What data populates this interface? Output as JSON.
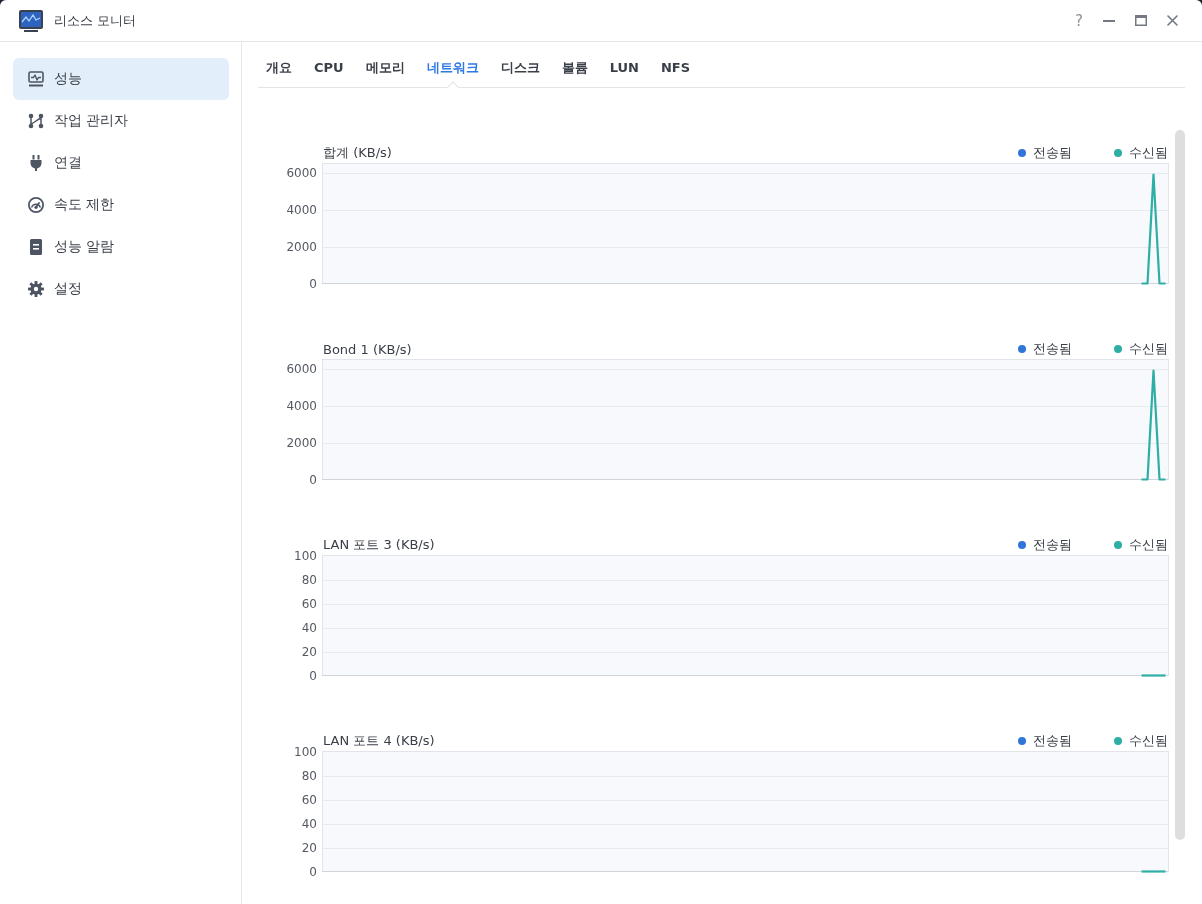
{
  "window": {
    "title": "리소스 모니터",
    "help": "?"
  },
  "sidebar": {
    "items": [
      {
        "label": "성능",
        "selected": true
      },
      {
        "label": "작업 관리자",
        "selected": false
      },
      {
        "label": "연결",
        "selected": false
      },
      {
        "label": "속도 제한",
        "selected": false
      },
      {
        "label": "성능 알람",
        "selected": false
      },
      {
        "label": "설정",
        "selected": false
      }
    ]
  },
  "tabs": [
    {
      "label": "개요",
      "selected": false
    },
    {
      "label": "CPU",
      "selected": false
    },
    {
      "label": "메모리",
      "selected": false
    },
    {
      "label": "네트워크",
      "selected": true
    },
    {
      "label": "디스크",
      "selected": false
    },
    {
      "label": "볼륨",
      "selected": false
    },
    {
      "label": "LUN",
      "selected": false
    },
    {
      "label": "NFS",
      "selected": false
    }
  ],
  "charts": [
    {
      "chart_data": {
        "type": "line",
        "title": "합계 (KB/s)",
        "grid": true,
        "categories": [
          null,
          null,
          null,
          null,
          null,
          null,
          null,
          null,
          null,
          null,
          null,
          null,
          null,
          null,
          null,
          null,
          null,
          null,
          null,
          null,
          null,
          null,
          null,
          null,
          null,
          null,
          null,
          null,
          null,
          null,
          null,
          null,
          null,
          null,
          null,
          null,
          null,
          null,
          null,
          null,
          null,
          null,
          null,
          null,
          null,
          null,
          null,
          null,
          null,
          null,
          null,
          null,
          null,
          null,
          null,
          null,
          null,
          null,
          null,
          null,
          null,
          null,
          null,
          null,
          null,
          null,
          null,
          null,
          null,
          null,
          null,
          null,
          null,
          null,
          null,
          null,
          null,
          null,
          null,
          null,
          null,
          null,
          null,
          null,
          null,
          null,
          null,
          null,
          null,
          null,
          null,
          null,
          null,
          null,
          null,
          null,
          null,
          null,
          null,
          null,
          null,
          null,
          null,
          null,
          null,
          null,
          null,
          null,
          null,
          null,
          null,
          null,
          null,
          null,
          null,
          null,
          null,
          null,
          null,
          null,
          null,
          null,
          null,
          null,
          null,
          null,
          null,
          null,
          null,
          null,
          null,
          null,
          null,
          null,
          null,
          null,
          null,
          null,
          null,
          null,
          null
        ],
        "ylim": [
          0,
          6500
        ],
        "yticks": [
          0,
          2000,
          4000,
          6000
        ],
        "series": [
          {
            "name": "전송됨",
            "color": "#2f76d9",
            "values": [
              null,
              null,
              null,
              null,
              null,
              null,
              null,
              null,
              null,
              null,
              null,
              null,
              null,
              null,
              null,
              null,
              null,
              null,
              null,
              null,
              null,
              null,
              null,
              null,
              null,
              null,
              null,
              null,
              null,
              null,
              null,
              null,
              null,
              null,
              null,
              null,
              null,
              null,
              null,
              null,
              null,
              null,
              null,
              null,
              null,
              null,
              null,
              null,
              null,
              null,
              null,
              null,
              null,
              null,
              null,
              null,
              null,
              null,
              null,
              null,
              null,
              null,
              null,
              null,
              null,
              null,
              null,
              null,
              null,
              null,
              null,
              null,
              null,
              null,
              null,
              null,
              null,
              null,
              null,
              null,
              null,
              null,
              null,
              null,
              null,
              null,
              null,
              null,
              null,
              null,
              null,
              null,
              null,
              null,
              null,
              null,
              null,
              null,
              null,
              null,
              null,
              null,
              null,
              null,
              null,
              null,
              null,
              null,
              null,
              null,
              null,
              null,
              null,
              null,
              null,
              null,
              null,
              null,
              null,
              null,
              null,
              null,
              null,
              null,
              null,
              null,
              null,
              null,
              null,
              null,
              null,
              null,
              null,
              null,
              null,
              null,
              null,
              null,
              null,
              null,
              null
            ]
          },
          {
            "name": "수신됨",
            "color": "#2eaea5",
            "values": [
              null,
              null,
              null,
              null,
              null,
              null,
              null,
              null,
              null,
              null,
              null,
              null,
              null,
              null,
              null,
              null,
              null,
              null,
              null,
              null,
              null,
              null,
              null,
              null,
              null,
              null,
              null,
              null,
              null,
              null,
              null,
              null,
              null,
              null,
              null,
              null,
              null,
              null,
              null,
              null,
              null,
              null,
              null,
              null,
              null,
              null,
              null,
              null,
              null,
              null,
              null,
              null,
              null,
              null,
              null,
              null,
              null,
              null,
              null,
              null,
              null,
              null,
              null,
              null,
              null,
              null,
              null,
              null,
              null,
              null,
              null,
              null,
              null,
              null,
              null,
              null,
              null,
              null,
              null,
              null,
              null,
              null,
              null,
              null,
              null,
              null,
              null,
              null,
              null,
              null,
              null,
              null,
              null,
              null,
              null,
              null,
              null,
              null,
              null,
              null,
              null,
              null,
              null,
              null,
              null,
              null,
              null,
              null,
              null,
              null,
              null,
              null,
              null,
              null,
              null,
              null,
              null,
              null,
              null,
              null,
              null,
              null,
              null,
              null,
              null,
              null,
              null,
              null,
              null,
              null,
              null,
              null,
              null,
              null,
              null,
              null,
              0,
              0,
              5900,
              0,
              0
            ]
          }
        ]
      }
    },
    {
      "chart_data": {
        "type": "line",
        "title": "Bond 1 (KB/s)",
        "grid": true,
        "categories": [
          null,
          null,
          null,
          null,
          null,
          null,
          null,
          null,
          null,
          null,
          null,
          null,
          null,
          null,
          null,
          null,
          null,
          null,
          null,
          null,
          null,
          null,
          null,
          null,
          null,
          null,
          null,
          null,
          null,
          null,
          null,
          null,
          null,
          null,
          null,
          null,
          null,
          null,
          null,
          null,
          null,
          null,
          null,
          null,
          null,
          null,
          null,
          null,
          null,
          null,
          null,
          null,
          null,
          null,
          null,
          null,
          null,
          null,
          null,
          null,
          null,
          null,
          null,
          null,
          null,
          null,
          null,
          null,
          null,
          null,
          null,
          null,
          null,
          null,
          null,
          null,
          null,
          null,
          null,
          null,
          null,
          null,
          null,
          null,
          null,
          null,
          null,
          null,
          null,
          null,
          null,
          null,
          null,
          null,
          null,
          null,
          null,
          null,
          null,
          null,
          null,
          null,
          null,
          null,
          null,
          null,
          null,
          null,
          null,
          null,
          null,
          null,
          null,
          null,
          null,
          null,
          null,
          null,
          null,
          null,
          null,
          null,
          null,
          null,
          null,
          null,
          null,
          null,
          null,
          null,
          null,
          null,
          null,
          null,
          null,
          null,
          null,
          null,
          null,
          null,
          null
        ],
        "ylim": [
          0,
          6500
        ],
        "yticks": [
          0,
          2000,
          4000,
          6000
        ],
        "series": [
          {
            "name": "전송됨",
            "color": "#2f76d9",
            "values": [
              null,
              null,
              null,
              null,
              null,
              null,
              null,
              null,
              null,
              null,
              null,
              null,
              null,
              null,
              null,
              null,
              null,
              null,
              null,
              null,
              null,
              null,
              null,
              null,
              null,
              null,
              null,
              null,
              null,
              null,
              null,
              null,
              null,
              null,
              null,
              null,
              null,
              null,
              null,
              null,
              null,
              null,
              null,
              null,
              null,
              null,
              null,
              null,
              null,
              null,
              null,
              null,
              null,
              null,
              null,
              null,
              null,
              null,
              null,
              null,
              null,
              null,
              null,
              null,
              null,
              null,
              null,
              null,
              null,
              null,
              null,
              null,
              null,
              null,
              null,
              null,
              null,
              null,
              null,
              null,
              null,
              null,
              null,
              null,
              null,
              null,
              null,
              null,
              null,
              null,
              null,
              null,
              null,
              null,
              null,
              null,
              null,
              null,
              null,
              null,
              null,
              null,
              null,
              null,
              null,
              null,
              null,
              null,
              null,
              null,
              null,
              null,
              null,
              null,
              null,
              null,
              null,
              null,
              null,
              null,
              null,
              null,
              null,
              null,
              null,
              null,
              null,
              null,
              null,
              null,
              null,
              null,
              null,
              null,
              null,
              null,
              null,
              null,
              null,
              null,
              null
            ]
          },
          {
            "name": "수신됨",
            "color": "#2eaea5",
            "values": [
              null,
              null,
              null,
              null,
              null,
              null,
              null,
              null,
              null,
              null,
              null,
              null,
              null,
              null,
              null,
              null,
              null,
              null,
              null,
              null,
              null,
              null,
              null,
              null,
              null,
              null,
              null,
              null,
              null,
              null,
              null,
              null,
              null,
              null,
              null,
              null,
              null,
              null,
              null,
              null,
              null,
              null,
              null,
              null,
              null,
              null,
              null,
              null,
              null,
              null,
              null,
              null,
              null,
              null,
              null,
              null,
              null,
              null,
              null,
              null,
              null,
              null,
              null,
              null,
              null,
              null,
              null,
              null,
              null,
              null,
              null,
              null,
              null,
              null,
              null,
              null,
              null,
              null,
              null,
              null,
              null,
              null,
              null,
              null,
              null,
              null,
              null,
              null,
              null,
              null,
              null,
              null,
              null,
              null,
              null,
              null,
              null,
              null,
              null,
              null,
              null,
              null,
              null,
              null,
              null,
              null,
              null,
              null,
              null,
              null,
              null,
              null,
              null,
              null,
              null,
              null,
              null,
              null,
              null,
              null,
              null,
              null,
              null,
              null,
              null,
              null,
              null,
              null,
              null,
              null,
              null,
              null,
              null,
              null,
              null,
              null,
              0,
              0,
              5900,
              0,
              0
            ]
          }
        ]
      }
    },
    {
      "chart_data": {
        "type": "line",
        "title": "LAN 포트 3 (KB/s)",
        "grid": true,
        "categories": [
          null,
          null,
          null,
          null,
          null,
          null,
          null,
          null,
          null,
          null,
          null,
          null,
          null,
          null,
          null,
          null,
          null,
          null,
          null,
          null,
          null,
          null,
          null,
          null,
          null,
          null,
          null,
          null,
          null,
          null,
          null,
          null,
          null,
          null,
          null,
          null,
          null,
          null,
          null,
          null,
          null,
          null,
          null,
          null,
          null,
          null,
          null,
          null,
          null,
          null,
          null,
          null,
          null,
          null,
          null,
          null,
          null,
          null,
          null,
          null,
          null,
          null,
          null,
          null,
          null,
          null,
          null,
          null,
          null,
          null,
          null,
          null,
          null,
          null,
          null,
          null,
          null,
          null,
          null,
          null,
          null,
          null,
          null,
          null,
          null,
          null,
          null,
          null,
          null,
          null,
          null,
          null,
          null,
          null,
          null,
          null,
          null,
          null,
          null,
          null,
          null,
          null,
          null,
          null,
          null,
          null,
          null,
          null,
          null,
          null,
          null,
          null,
          null,
          null,
          null,
          null,
          null,
          null,
          null,
          null,
          null,
          null,
          null,
          null,
          null,
          null,
          null,
          null,
          null,
          null,
          null,
          null,
          null,
          null,
          null,
          null,
          null,
          null,
          null,
          null,
          null
        ],
        "ylim": [
          0,
          100
        ],
        "yticks": [
          0,
          20,
          40,
          60,
          80,
          100
        ],
        "series": [
          {
            "name": "전송됨",
            "color": "#2f76d9",
            "values": [
              null,
              null,
              null,
              null,
              null,
              null,
              null,
              null,
              null,
              null,
              null,
              null,
              null,
              null,
              null,
              null,
              null,
              null,
              null,
              null,
              null,
              null,
              null,
              null,
              null,
              null,
              null,
              null,
              null,
              null,
              null,
              null,
              null,
              null,
              null,
              null,
              null,
              null,
              null,
              null,
              null,
              null,
              null,
              null,
              null,
              null,
              null,
              null,
              null,
              null,
              null,
              null,
              null,
              null,
              null,
              null,
              null,
              null,
              null,
              null,
              null,
              null,
              null,
              null,
              null,
              null,
              null,
              null,
              null,
              null,
              null,
              null,
              null,
              null,
              null,
              null,
              null,
              null,
              null,
              null,
              null,
              null,
              null,
              null,
              null,
              null,
              null,
              null,
              null,
              null,
              null,
              null,
              null,
              null,
              null,
              null,
              null,
              null,
              null,
              null,
              null,
              null,
              null,
              null,
              null,
              null,
              null,
              null,
              null,
              null,
              null,
              null,
              null,
              null,
              null,
              null,
              null,
              null,
              null,
              null,
              null,
              null,
              null,
              null,
              null,
              null,
              null,
              null,
              null,
              null,
              null,
              null,
              null,
              null,
              null,
              null,
              null,
              null,
              null,
              null,
              null
            ]
          },
          {
            "name": "수신됨",
            "color": "#2eaea5",
            "values": [
              null,
              null,
              null,
              null,
              null,
              null,
              null,
              null,
              null,
              null,
              null,
              null,
              null,
              null,
              null,
              null,
              null,
              null,
              null,
              null,
              null,
              null,
              null,
              null,
              null,
              null,
              null,
              null,
              null,
              null,
              null,
              null,
              null,
              null,
              null,
              null,
              null,
              null,
              null,
              null,
              null,
              null,
              null,
              null,
              null,
              null,
              null,
              null,
              null,
              null,
              null,
              null,
              null,
              null,
              null,
              null,
              null,
              null,
              null,
              null,
              null,
              null,
              null,
              null,
              null,
              null,
              null,
              null,
              null,
              null,
              null,
              null,
              null,
              null,
              null,
              null,
              null,
              null,
              null,
              null,
              null,
              null,
              null,
              null,
              null,
              null,
              null,
              null,
              null,
              null,
              null,
              null,
              null,
              null,
              null,
              null,
              null,
              null,
              null,
              null,
              null,
              null,
              null,
              null,
              null,
              null,
              null,
              null,
              null,
              null,
              null,
              null,
              null,
              null,
              null,
              null,
              null,
              null,
              null,
              null,
              null,
              null,
              null,
              null,
              null,
              null,
              null,
              null,
              null,
              null,
              null,
              null,
              null,
              null,
              null,
              null,
              0,
              0,
              0,
              0,
              0
            ]
          }
        ]
      }
    },
    {
      "chart_data": {
        "type": "line",
        "title": "LAN 포트 4 (KB/s)",
        "grid": true,
        "categories": [
          null,
          null,
          null,
          null,
          null,
          null,
          null,
          null,
          null,
          null,
          null,
          null,
          null,
          null,
          null,
          null,
          null,
          null,
          null,
          null,
          null,
          null,
          null,
          null,
          null,
          null,
          null,
          null,
          null,
          null,
          null,
          null,
          null,
          null,
          null,
          null,
          null,
          null,
          null,
          null,
          null,
          null,
          null,
          null,
          null,
          null,
          null,
          null,
          null,
          null,
          null,
          null,
          null,
          null,
          null,
          null,
          null,
          null,
          null,
          null,
          null,
          null,
          null,
          null,
          null,
          null,
          null,
          null,
          null,
          null,
          null,
          null,
          null,
          null,
          null,
          null,
          null,
          null,
          null,
          null,
          null,
          null,
          null,
          null,
          null,
          null,
          null,
          null,
          null,
          null,
          null,
          null,
          null,
          null,
          null,
          null,
          null,
          null,
          null,
          null,
          null,
          null,
          null,
          null,
          null,
          null,
          null,
          null,
          null,
          null,
          null,
          null,
          null,
          null,
          null,
          null,
          null,
          null,
          null,
          null,
          null,
          null,
          null,
          null,
          null,
          null,
          null,
          null,
          null,
          null,
          null,
          null,
          null,
          null,
          null,
          null,
          null,
          null,
          null,
          null,
          null
        ],
        "ylim": [
          0,
          100
        ],
        "yticks": [
          0,
          20,
          40,
          60,
          80,
          100
        ],
        "series": [
          {
            "name": "전송됨",
            "color": "#2f76d9",
            "values": [
              null,
              null,
              null,
              null,
              null,
              null,
              null,
              null,
              null,
              null,
              null,
              null,
              null,
              null,
              null,
              null,
              null,
              null,
              null,
              null,
              null,
              null,
              null,
              null,
              null,
              null,
              null,
              null,
              null,
              null,
              null,
              null,
              null,
              null,
              null,
              null,
              null,
              null,
              null,
              null,
              null,
              null,
              null,
              null,
              null,
              null,
              null,
              null,
              null,
              null,
              null,
              null,
              null,
              null,
              null,
              null,
              null,
              null,
              null,
              null,
              null,
              null,
              null,
              null,
              null,
              null,
              null,
              null,
              null,
              null,
              null,
              null,
              null,
              null,
              null,
              null,
              null,
              null,
              null,
              null,
              null,
              null,
              null,
              null,
              null,
              null,
              null,
              null,
              null,
              null,
              null,
              null,
              null,
              null,
              null,
              null,
              null,
              null,
              null,
              null,
              null,
              null,
              null,
              null,
              null,
              null,
              null,
              null,
              null,
              null,
              null,
              null,
              null,
              null,
              null,
              null,
              null,
              null,
              null,
              null,
              null,
              null,
              null,
              null,
              null,
              null,
              null,
              null,
              null,
              null,
              null,
              null,
              null,
              null,
              null,
              null,
              null,
              null,
              null,
              null,
              null
            ]
          },
          {
            "name": "수신됨",
            "color": "#2eaea5",
            "values": [
              null,
              null,
              null,
              null,
              null,
              null,
              null,
              null,
              null,
              null,
              null,
              null,
              null,
              null,
              null,
              null,
              null,
              null,
              null,
              null,
              null,
              null,
              null,
              null,
              null,
              null,
              null,
              null,
              null,
              null,
              null,
              null,
              null,
              null,
              null,
              null,
              null,
              null,
              null,
              null,
              null,
              null,
              null,
              null,
              null,
              null,
              null,
              null,
              null,
              null,
              null,
              null,
              null,
              null,
              null,
              null,
              null,
              null,
              null,
              null,
              null,
              null,
              null,
              null,
              null,
              null,
              null,
              null,
              null,
              null,
              null,
              null,
              null,
              null,
              null,
              null,
              null,
              null,
              null,
              null,
              null,
              null,
              null,
              null,
              null,
              null,
              null,
              null,
              null,
              null,
              null,
              null,
              null,
              null,
              null,
              null,
              null,
              null,
              null,
              null,
              null,
              null,
              null,
              null,
              null,
              null,
              null,
              null,
              null,
              null,
              null,
              null,
              null,
              null,
              null,
              null,
              null,
              null,
              null,
              null,
              null,
              null,
              null,
              null,
              null,
              null,
              null,
              null,
              null,
              null,
              null,
              null,
              null,
              null,
              null,
              null,
              0,
              0,
              0,
              0,
              0
            ]
          }
        ]
      }
    }
  ]
}
